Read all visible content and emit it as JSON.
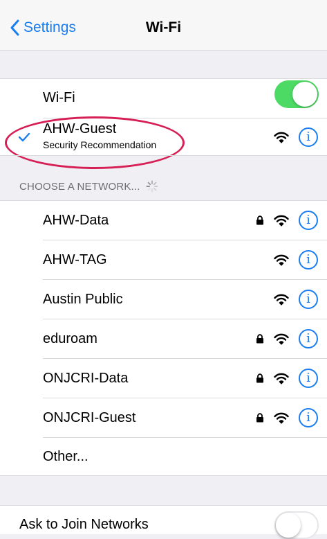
{
  "nav": {
    "back_label": "Settings",
    "title": "Wi-Fi"
  },
  "wifi_toggle": {
    "label": "Wi-Fi",
    "on": true
  },
  "connected": {
    "name": "AHW-Guest",
    "subtitle": "Security Recommendation"
  },
  "section_header": "CHOOSE A NETWORK...",
  "networks": [
    {
      "name": "AHW-Data",
      "locked": true
    },
    {
      "name": "AHW-TAG",
      "locked": false
    },
    {
      "name": "Austin Public",
      "locked": false
    },
    {
      "name": "eduroam",
      "locked": true
    },
    {
      "name": "ONJCRI-Data",
      "locked": true
    },
    {
      "name": "ONJCRI-Guest",
      "locked": true
    }
  ],
  "other_label": "Other...",
  "ask_to_join": {
    "label": "Ask to Join Networks",
    "on": false
  },
  "info_glyph": "i",
  "colors": {
    "accent": "#1a7ef0",
    "toggle_on": "#4cd964",
    "highlight": "#d61f55"
  }
}
